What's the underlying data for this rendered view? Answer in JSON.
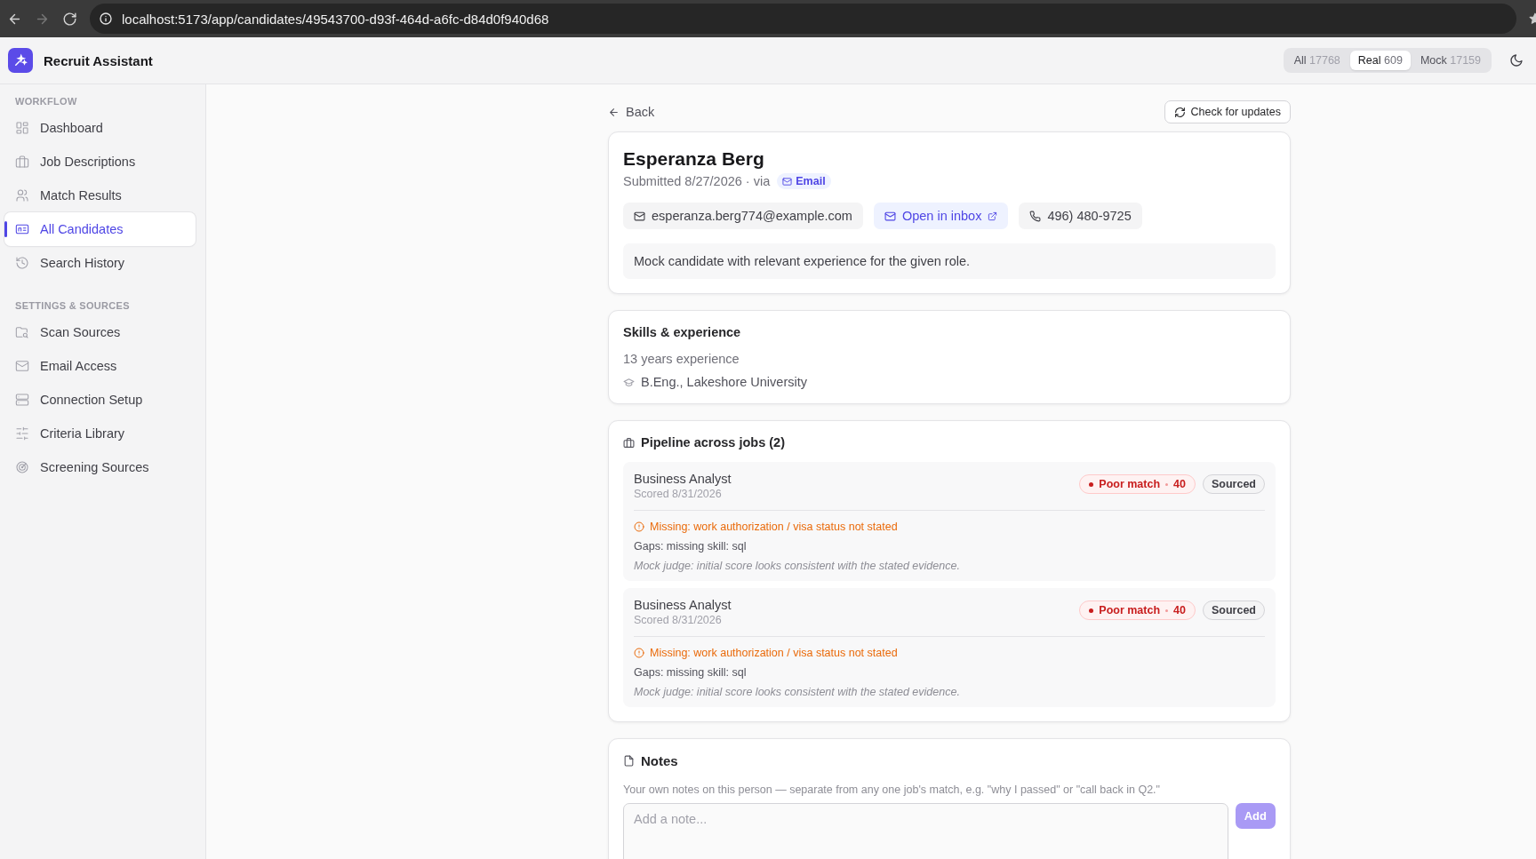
{
  "browser": {
    "url": "localhost:5173/app/candidates/49543700-d93f-464d-a6fc-d84d0f940d68"
  },
  "app": {
    "title": "Recruit Assistant"
  },
  "filter_tabs": [
    {
      "label": "All",
      "count": "17768",
      "selected": false
    },
    {
      "label": "Real",
      "count": "609",
      "selected": true
    },
    {
      "label": "Mock",
      "count": "17159",
      "selected": false
    }
  ],
  "sidebar": {
    "sections": [
      {
        "heading": "WORKFLOW",
        "items": [
          {
            "label": "Dashboard",
            "selected": false
          },
          {
            "label": "Job Descriptions",
            "selected": false
          },
          {
            "label": "Match Results",
            "selected": false
          },
          {
            "label": "All Candidates",
            "selected": true
          },
          {
            "label": "Search History",
            "selected": false
          }
        ]
      },
      {
        "heading": "SETTINGS & SOURCES",
        "items": [
          {
            "label": "Scan Sources",
            "selected": false
          },
          {
            "label": "Email Access",
            "selected": false
          },
          {
            "label": "Connection Setup",
            "selected": false
          },
          {
            "label": "Criteria Library",
            "selected": false
          },
          {
            "label": "Screening Sources",
            "selected": false
          }
        ]
      }
    ]
  },
  "back_link": "Back",
  "check_button": "Check for updates",
  "candidate": {
    "name": "Esperanza Berg",
    "submitted": "Submitted 8/27/2026 · via",
    "source": "Email",
    "email": "esperanza.berg774@example.com",
    "open_inbox": "Open in inbox",
    "phone": "496) 480-9725",
    "summary": "Mock candidate with relevant experience for the given role."
  },
  "skills": {
    "title": "Skills & experience",
    "experience": "13 years experience",
    "education": "B.Eng., Lakeshore University"
  },
  "pipeline": {
    "title": "Pipeline across jobs (2)",
    "jobs": [
      {
        "title": "Business Analyst",
        "scored": "Scored 8/31/2026",
        "match": "Poor match",
        "score": "40",
        "status": "Sourced",
        "warning": "Missing: work authorization / visa status not stated",
        "gaps": "Gaps: missing skill: sql",
        "judge": "Mock judge: initial score looks consistent with the stated evidence."
      },
      {
        "title": "Business Analyst",
        "scored": "Scored 8/31/2026",
        "match": "Poor match",
        "score": "40",
        "status": "Sourced",
        "warning": "Missing: work authorization / visa status not stated",
        "gaps": "Gaps: missing skill: sql",
        "judge": "Mock judge: initial score looks consistent with the stated evidence."
      }
    ]
  },
  "notes": {
    "title": "Notes",
    "hint": "Your own notes on this person — separate from any one job's match, e.g. \"why I passed\" or \"call back in Q2.\"",
    "placeholder": "Add a note...",
    "add_button": {
      "label": "Add",
      "disabled": true
    }
  }
}
